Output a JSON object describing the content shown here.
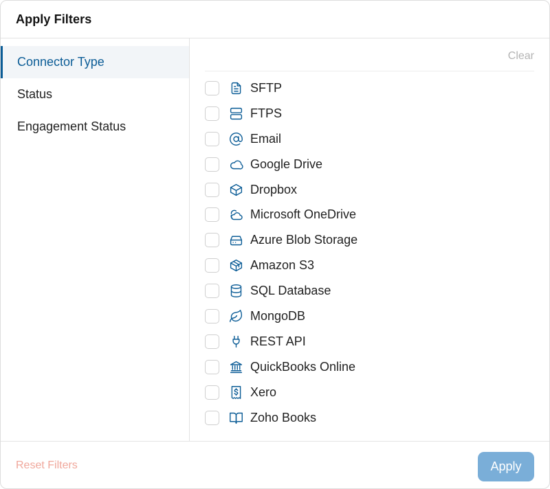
{
  "header": {
    "title": "Apply Filters"
  },
  "sidebar": {
    "items": [
      {
        "label": "Connector Type",
        "active": true
      },
      {
        "label": "Status",
        "active": false
      },
      {
        "label": "Engagement Status",
        "active": false
      }
    ]
  },
  "content": {
    "clear_label": "Clear",
    "options": [
      {
        "label": "SFTP",
        "icon": "document-icon",
        "checked": false
      },
      {
        "label": "FTPS",
        "icon": "server-icon",
        "checked": false
      },
      {
        "label": "Email",
        "icon": "at-sign-icon",
        "checked": false
      },
      {
        "label": "Google Drive",
        "icon": "cloud-icon",
        "checked": false
      },
      {
        "label": "Dropbox",
        "icon": "box-icon",
        "checked": false
      },
      {
        "label": "Microsoft OneDrive",
        "icon": "cloud-sun-icon",
        "checked": false
      },
      {
        "label": "Azure Blob Storage",
        "icon": "hard-drive-icon",
        "checked": false
      },
      {
        "label": "Amazon S3",
        "icon": "boxes-icon",
        "checked": false
      },
      {
        "label": "SQL Database",
        "icon": "database-icon",
        "checked": false
      },
      {
        "label": "MongoDB",
        "icon": "leaf-icon",
        "checked": false
      },
      {
        "label": "REST API",
        "icon": "plug-icon",
        "checked": false
      },
      {
        "label": "QuickBooks Online",
        "icon": "bank-icon",
        "checked": false
      },
      {
        "label": "Xero",
        "icon": "receipt-dollar-icon",
        "checked": false
      },
      {
        "label": "Zoho Books",
        "icon": "book-open-icon",
        "checked": false
      }
    ]
  },
  "footer": {
    "reset_label": "Reset Filters",
    "apply_label": "Apply"
  },
  "colors": {
    "accent": "#0b5c96",
    "apply_button": "#7aaed8",
    "reset_text": "#f0a79b",
    "clear_text": "#b3b3b3"
  }
}
